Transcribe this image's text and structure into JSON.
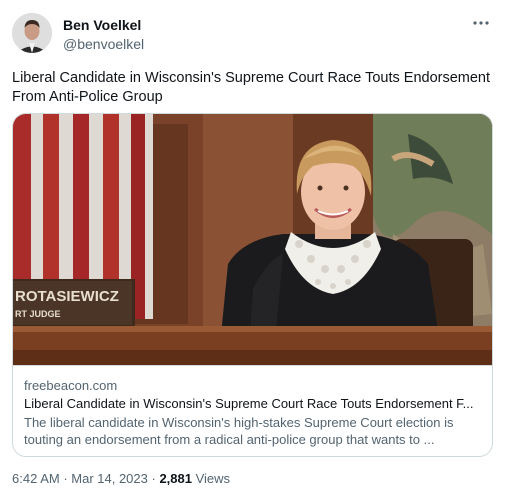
{
  "author": {
    "name": "Ben Voelkel",
    "handle": "@benvoelkel"
  },
  "tweet": {
    "text": "Liberal Candidate in Wisconsin's Supreme Court Race Touts Endorsement From Anti-Police Group"
  },
  "card": {
    "image": {
      "nameplate_line1": "ROTASIEWICZ",
      "nameplate_line2": "RT JUDGE"
    },
    "domain": "freebeacon.com",
    "title": "Liberal Candidate in Wisconsin's Supreme Court Race Touts Endorsement F...",
    "description": "The liberal candidate in Wisconsin's high-stakes Supreme Court election is touting an endorsement from a radical anti-police group that wants to ..."
  },
  "meta": {
    "time": "6:42 AM",
    "separator": " · ",
    "date": "Mar 14, 2023",
    "views_count": "2,881",
    "views_label": " Views"
  },
  "icons": {
    "more": "more-horizontal-icon"
  },
  "colors": {
    "text_primary": "#0f1419",
    "text_secondary": "#536471",
    "border": "#cfd9de"
  }
}
